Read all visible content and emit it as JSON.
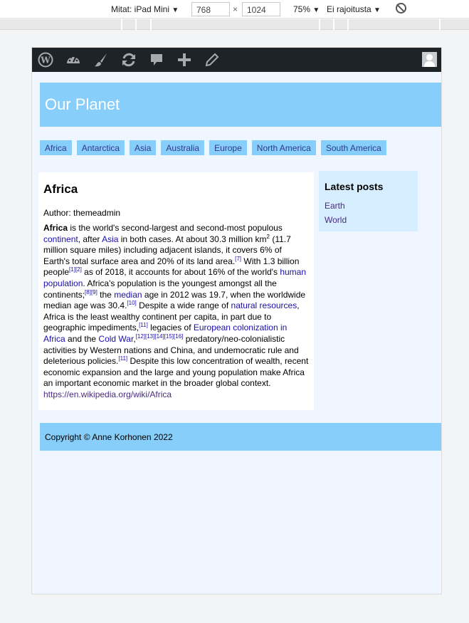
{
  "devtools": {
    "device_label": "Mitat: iPad Mini",
    "width": "768",
    "times": "×",
    "height": "1024",
    "zoom": "75%",
    "throttle": "Ei rajoitusta",
    "dropdown_glyph": "▼"
  },
  "adminbar": {
    "icons": [
      "wordpress-icon",
      "dashboard-icon",
      "customize-brush-icon",
      "updates-icon",
      "comments-icon",
      "new-content-icon",
      "edit-icon",
      "avatar"
    ]
  },
  "site": {
    "title": "Our Planet"
  },
  "nav": {
    "items": [
      "Africa",
      "Antarctica",
      "Asia",
      "Australia",
      "Europe",
      "North America",
      "South America"
    ]
  },
  "article": {
    "title": "Africa",
    "author": "Author: themeadmin",
    "p1_strong": "Africa",
    "p1_a": " is the world's second-largest and second-most populous ",
    "link_continent": "continent",
    "p1_b": ", after ",
    "link_asia": "Asia",
    "p1_c": " in both cases. At about 30.3 million km",
    "sup_2": "2",
    "p1_d": " (11.7 million square miles) including adjacent islands, it covers 6% of Earth's total surface area and 20% of its land area.",
    "ref_7": "[7]",
    "p1_e": " With 1.3 billion people",
    "ref_1_2": "[1][2]",
    "p1_f": " as of 2018, it accounts for about 16% of the world's ",
    "link_human_population": "human population",
    "p1_g": ". Africa's population is the youngest amongst all the continents;",
    "ref_8_9": "[8][9]",
    "p1_h": " the ",
    "link_median": "median",
    "p1_i": " age in 2012 was 19.7, when the worldwide median age was 30.4.",
    "ref_10": "[10]",
    "p1_j": " Despite a wide range of ",
    "link_natural_resources": "natural resources",
    "p1_k": ", Africa is the least wealthy continent per capita, in part due to geographic impediments,",
    "ref_11a": "[11]",
    "p1_l": " legacies of ",
    "link_european_colonization": "European colonization in Africa",
    "p1_m": " and the ",
    "link_cold_war": "Cold War",
    "p1_n": ",",
    "ref_12_16": "[12][13][14][15][16]",
    "p1_o": " predatory/neo-colonialistic activities by Western nations and China, and undemocratic rule and deleterious policies.",
    "ref_11b": "[11]",
    "p1_p": " Despite this low concentration of wealth, recent economic expansion and the large and young population make Africa an important economic market in the broader global context. ",
    "link_wiki": "https://en.wikipedia.org/wiki/Africa"
  },
  "sidebar": {
    "heading": "Latest posts",
    "items": [
      "Earth",
      "World"
    ]
  },
  "footer": {
    "copyright": "Copyright © Anne Korhonen 2022"
  },
  "colors": {
    "header_bg": "#87cefa",
    "page_bg": "#eff6ff",
    "adminbar_bg": "#1d2327",
    "link": "#1a0dab"
  }
}
